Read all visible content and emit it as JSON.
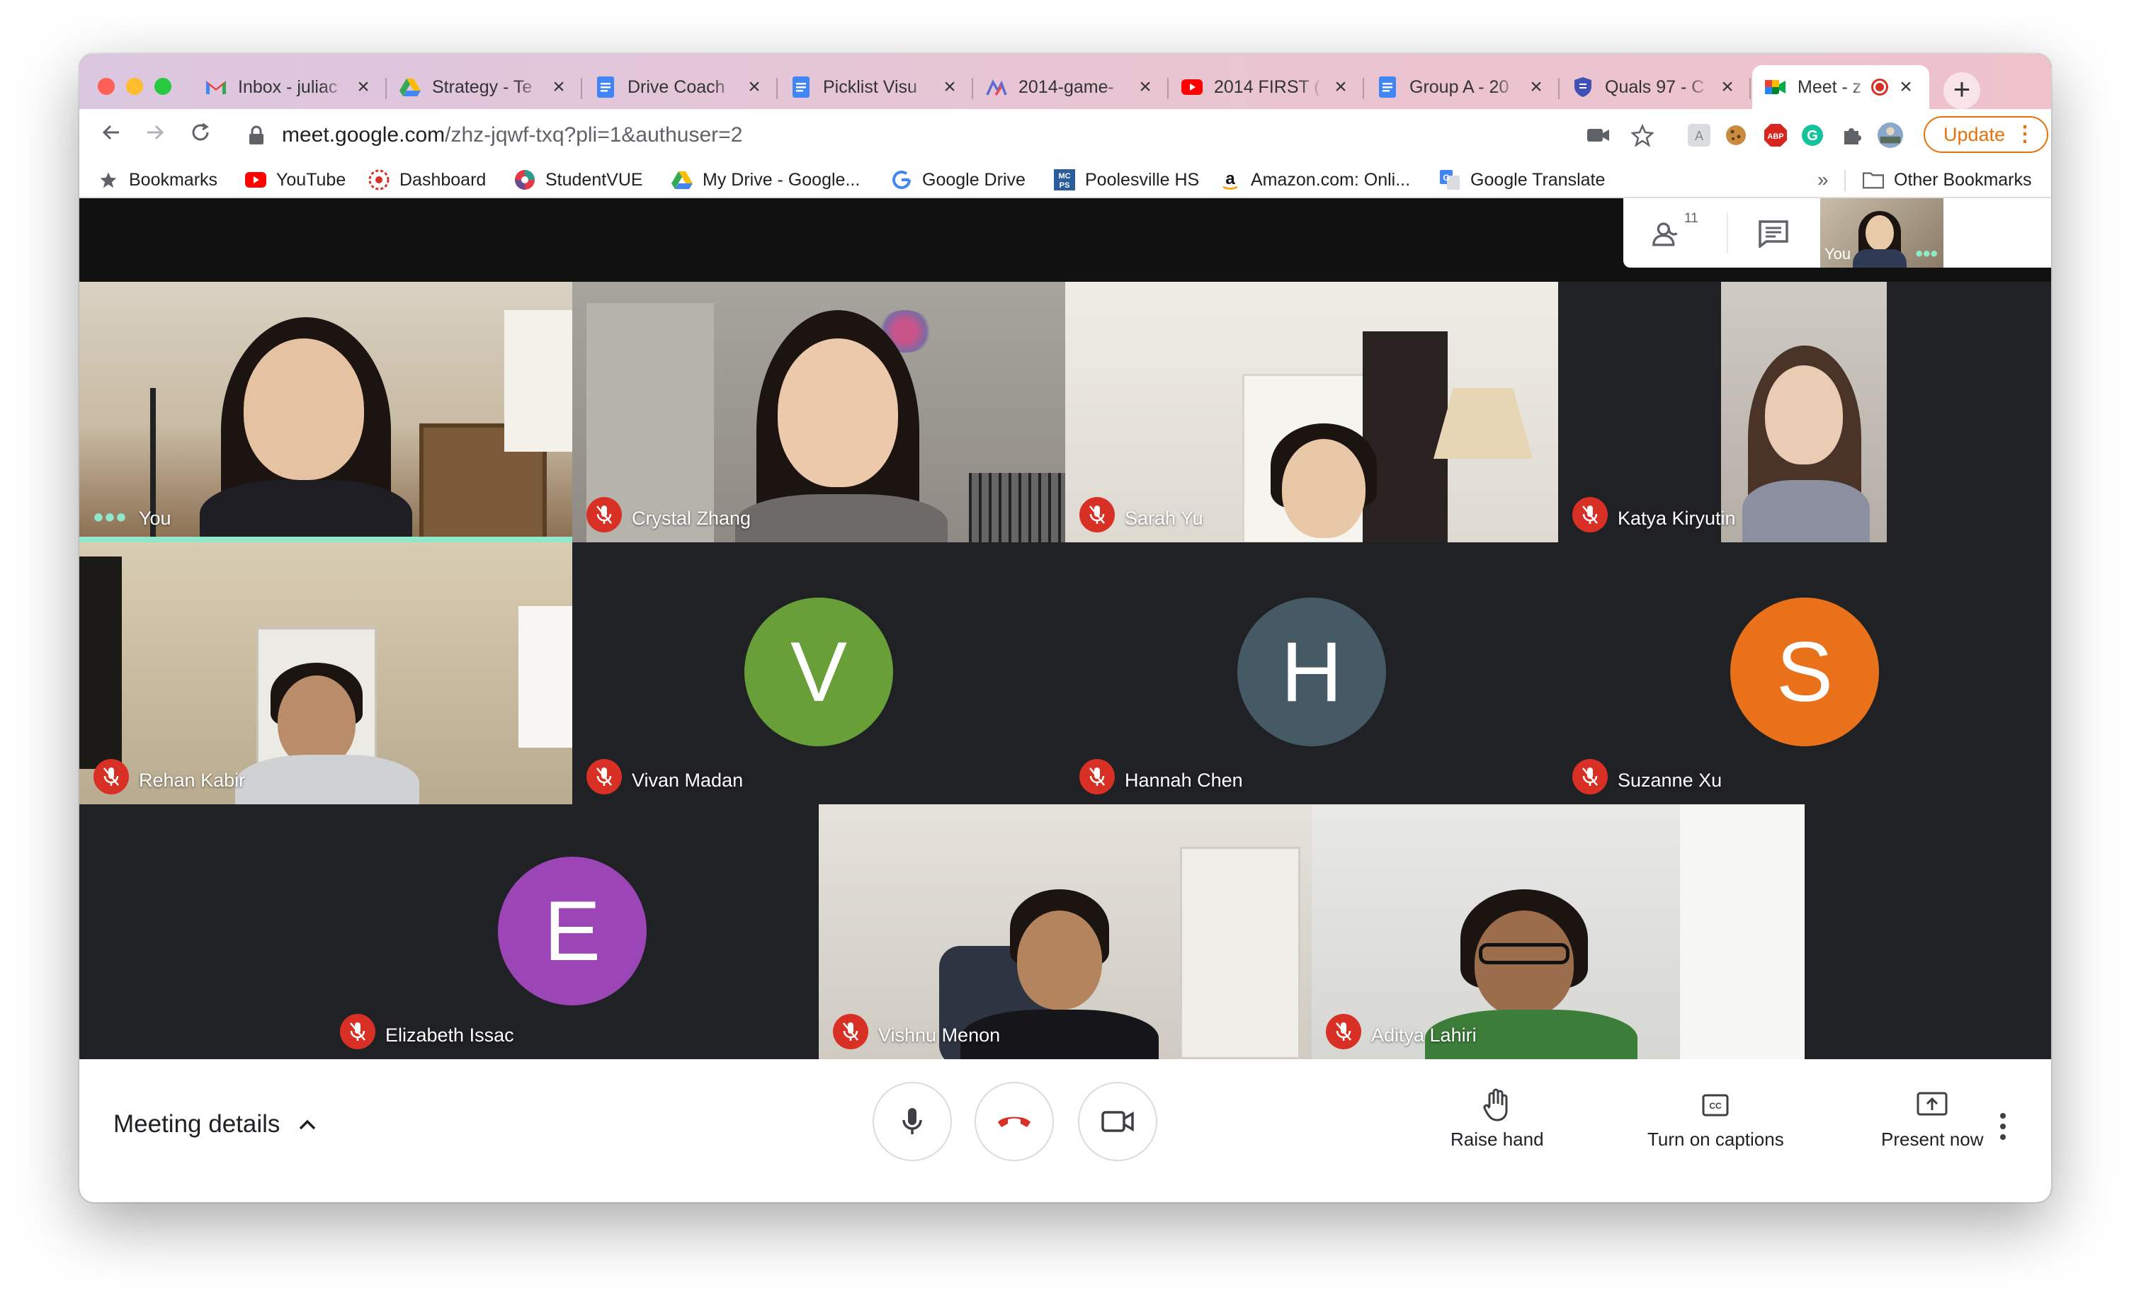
{
  "browser": {
    "tabs": [
      {
        "label": "Inbox - juliac",
        "icon": "gmail-icon"
      },
      {
        "label": "Strategy - Te",
        "icon": "google-drive-icon"
      },
      {
        "label": "Drive Coach",
        "icon": "google-docs-icon"
      },
      {
        "label": "Picklist Visu",
        "icon": "google-docs-icon"
      },
      {
        "label": "2014-game-",
        "icon": "chart-icon"
      },
      {
        "label": "2014 FIRST (",
        "icon": "youtube-icon"
      },
      {
        "label": "Group A - 20",
        "icon": "google-docs-icon"
      },
      {
        "label": "Quals 97 - C",
        "icon": "shield-icon"
      },
      {
        "label": "Meet - z",
        "icon": "google-meet-icon",
        "active": true
      }
    ],
    "new_tab": "+",
    "url_host": "meet.google.com",
    "url_path": "/zhz-jqwf-txq?pli=1&authuser=2",
    "update_label": "Update",
    "bookmarks": [
      {
        "label": "Bookmarks",
        "icon": "star-icon"
      },
      {
        "label": "YouTube",
        "icon": "youtube-icon"
      },
      {
        "label": "Dashboard",
        "icon": "dashboard-icon"
      },
      {
        "label": "StudentVUE",
        "icon": "studentvue-icon"
      },
      {
        "label": "My Drive - Google...",
        "icon": "google-drive-icon"
      },
      {
        "label": "Google Drive",
        "icon": "google-icon"
      },
      {
        "label": "Poolesville HS",
        "icon": "mcps-icon"
      },
      {
        "label": "Amazon.com: Onli...",
        "icon": "amazon-icon"
      },
      {
        "label": "Google Translate",
        "icon": "translate-icon"
      }
    ],
    "bookmarks_overflow": "»",
    "other_bookmarks": "Other Bookmarks"
  },
  "meet": {
    "participants_count": "11",
    "self_view_label": "You",
    "tiles": [
      {
        "name": "You",
        "muted": false,
        "speaking": true
      },
      {
        "name": "Crystal Zhang",
        "muted": true
      },
      {
        "name": "Sarah Yu",
        "muted": true
      },
      {
        "name": "Katya Kiryutin",
        "muted": true
      },
      {
        "name": "Rehan Kabir",
        "muted": true
      },
      {
        "name": "Vivan Madan",
        "muted": true,
        "initial": "V",
        "color": "#689f38"
      },
      {
        "name": "Hannah Chen",
        "muted": true,
        "initial": "H",
        "color": "#455a64"
      },
      {
        "name": "Suzanne Xu",
        "muted": true,
        "initial": "S",
        "color": "#e8711a"
      },
      {
        "name": "Elizabeth Issac",
        "muted": true,
        "initial": "E",
        "color": "#9c45b7"
      },
      {
        "name": "Vishnu Menon",
        "muted": true
      },
      {
        "name": "Aditya Lahiri",
        "muted": true
      }
    ],
    "bottom": {
      "meeting_details": "Meeting details",
      "raise_hand": "Raise hand",
      "captions": "Turn on captions",
      "present": "Present now"
    }
  },
  "colors": {
    "meet_bg": "#202124",
    "mute_red": "#d93025",
    "speaking_accent": "#8ee8c9",
    "update_orange": "#e8710a"
  }
}
